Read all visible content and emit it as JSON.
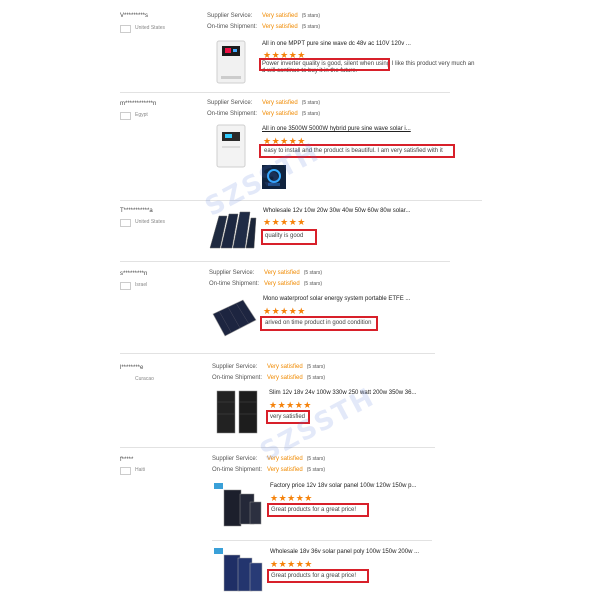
{
  "reviews": [
    {
      "buyer": "V*********s",
      "country": "United States",
      "supplier_service_label": "Supplier Service:",
      "supplier_service_value": "Very satisfied",
      "supplier_service_stars": "(5 stars)",
      "shipment_label": "On-time Shipment:",
      "shipment_value": "Very satisfied",
      "shipment_stars": "(5 stars)",
      "product_title": "All in one MPPT pure sine wave dc 48v ac 110V 120v ...",
      "rating": "★★★★★",
      "comment_line1_boxed": "Power inverter quality is good, silent when using",
      "comment_line1_rest": " I like this product very much an",
      "comment_line2": "d will continue to buy it in the future."
    },
    {
      "buyer": "m************n",
      "country": "Egypt",
      "supplier_service_label": "Supplier Service:",
      "supplier_service_value": "Very satisfied",
      "supplier_service_stars": "(5 stars)",
      "shipment_label": "On-time Shipment:",
      "shipment_value": "Very satisfied",
      "shipment_stars": "(5 stars)",
      "product_title": "All in one 3500W 5000W hybrid pure sine wave solar i...",
      "rating": "★★★★★",
      "comment": "easy to install and the product is beautiful. I am very satisfied with it"
    },
    {
      "buyer": "T***********a",
      "country": "United States",
      "product_title": "Wholesale 12v 10w 20w 30w 40w 50w 60w 80w solar...",
      "rating": "★★★★★",
      "comment": "quality is good"
    },
    {
      "buyer": "s*********n",
      "country": "Israel",
      "supplier_service_label": "Supplier Service:",
      "supplier_service_value": "Very satisfied",
      "supplier_service_stars": "(5 stars)",
      "shipment_label": "On-time Shipment:",
      "shipment_value": "Very satisfied",
      "shipment_stars": "(5 stars)",
      "product_title": "Mono waterproof solar energy system portable ETFE ...",
      "rating": "★★★★★",
      "comment": "arived on time product in good condition"
    },
    {
      "buyer": "l********e",
      "country": "Curacao",
      "supplier_service_label": "Supplier Service:",
      "supplier_service_value": "Very satisfied",
      "supplier_service_stars": "(5 stars)",
      "shipment_label": "On-time Shipment:",
      "shipment_value": "Very satisfied",
      "shipment_stars": "(5 stars)",
      "product_title": "Slim 12v 18v 24v 100w 330w 250 watt 200w 350w 36...",
      "rating": "★★★★★",
      "comment": "very satisfied"
    },
    {
      "buyer": "f*****",
      "country": "Haiti",
      "supplier_service_label": "Supplier Service:",
      "supplier_service_value": "Very satisfied",
      "supplier_service_stars": "(5 stars)",
      "shipment_label": "On-time Shipment:",
      "shipment_value": "Very satisfied",
      "shipment_stars": "(5 stars)",
      "product_title": "Factory price 12v 18v solar panel 100w 120w 150w p...",
      "rating": "★★★★★",
      "comment": "Great products for a great price!"
    },
    {
      "product_title": "Wholesale 18v 36v solar panel poly 100w 150w 200w ...",
      "rating": "★★★★★",
      "comment": "Great products for a great price!"
    }
  ],
  "watermark": "SZSSTH",
  "colors": {
    "accent": "#f08a00",
    "highlight_box": "#d8202a",
    "star": "#f5820a"
  }
}
